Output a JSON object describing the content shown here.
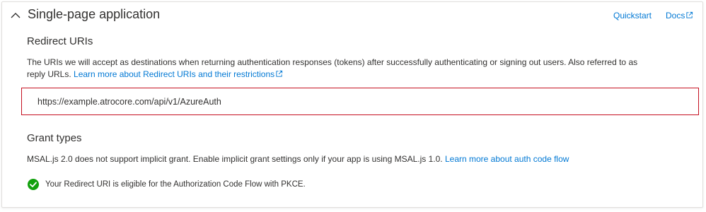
{
  "section": {
    "title": "Single-page application",
    "quickstart_label": "Quickstart",
    "docs_label": "Docs"
  },
  "redirect": {
    "heading": "Redirect URIs",
    "description_line1": "The URIs we will accept as destinations when returning authentication responses (tokens) after successfully authenticating or signing out users. Also referred to as",
    "description_line2": "reply URLs.",
    "learn_more": "Learn more about Redirect URIs and their restrictions",
    "uri_value": "https://example.atrocore.com/api/v1/AzureAuth"
  },
  "grant": {
    "heading": "Grant types",
    "description": "MSAL.js 2.0 does not support implicit grant. Enable implicit grant settings only if your app is using MSAL.js 1.0.",
    "learn_more": "Learn more about auth code flow"
  },
  "status": {
    "message": "Your Redirect URI is eligible for the Authorization Code Flow with PKCE."
  },
  "colors": {
    "accent": "#0078d4",
    "error_border": "#c50f1f",
    "success": "#13a10e"
  }
}
